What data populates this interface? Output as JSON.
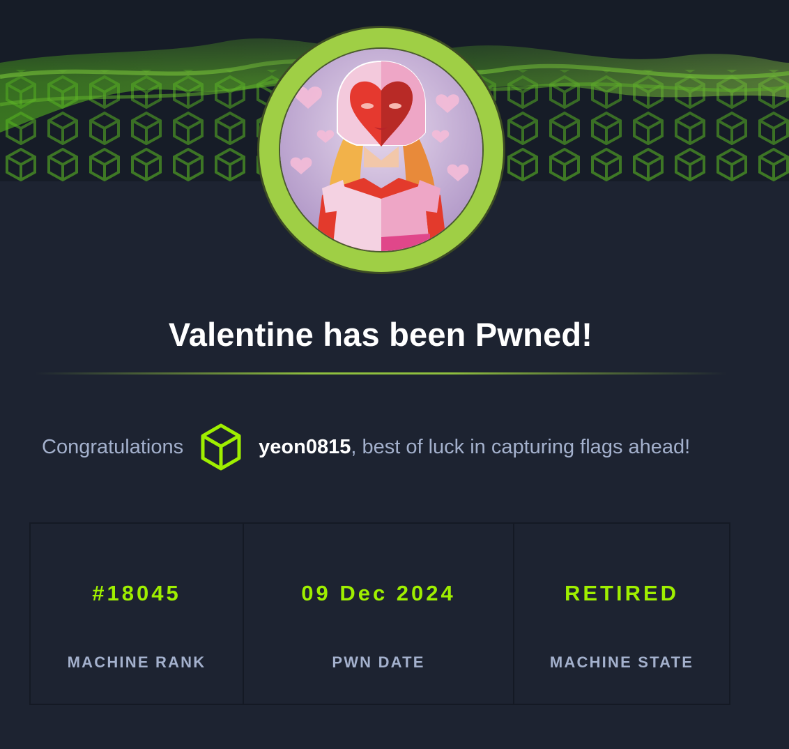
{
  "banner": {
    "image": "green-hex-wave-banner",
    "accent": "#9fef00"
  },
  "avatar": {
    "image": "valentine-heart-mask-avatar",
    "ring_color": "#9fcf45"
  },
  "title": "Valentine has been Pwned!",
  "congrats": {
    "prefix": "Congratulations",
    "icon": "cube-icon",
    "username": "yeon0815",
    "suffix": ", best of luck in capturing flags ahead!"
  },
  "stats": [
    {
      "value": "#18045",
      "label": "MACHINE RANK"
    },
    {
      "value": "09 Dec 2024",
      "label": "PWN DATE"
    },
    {
      "value": "RETIRED",
      "label": "MACHINE STATE"
    }
  ],
  "colors": {
    "background": "#1d2331",
    "accent_green": "#9fef00",
    "muted_text": "#a4b1cd"
  }
}
